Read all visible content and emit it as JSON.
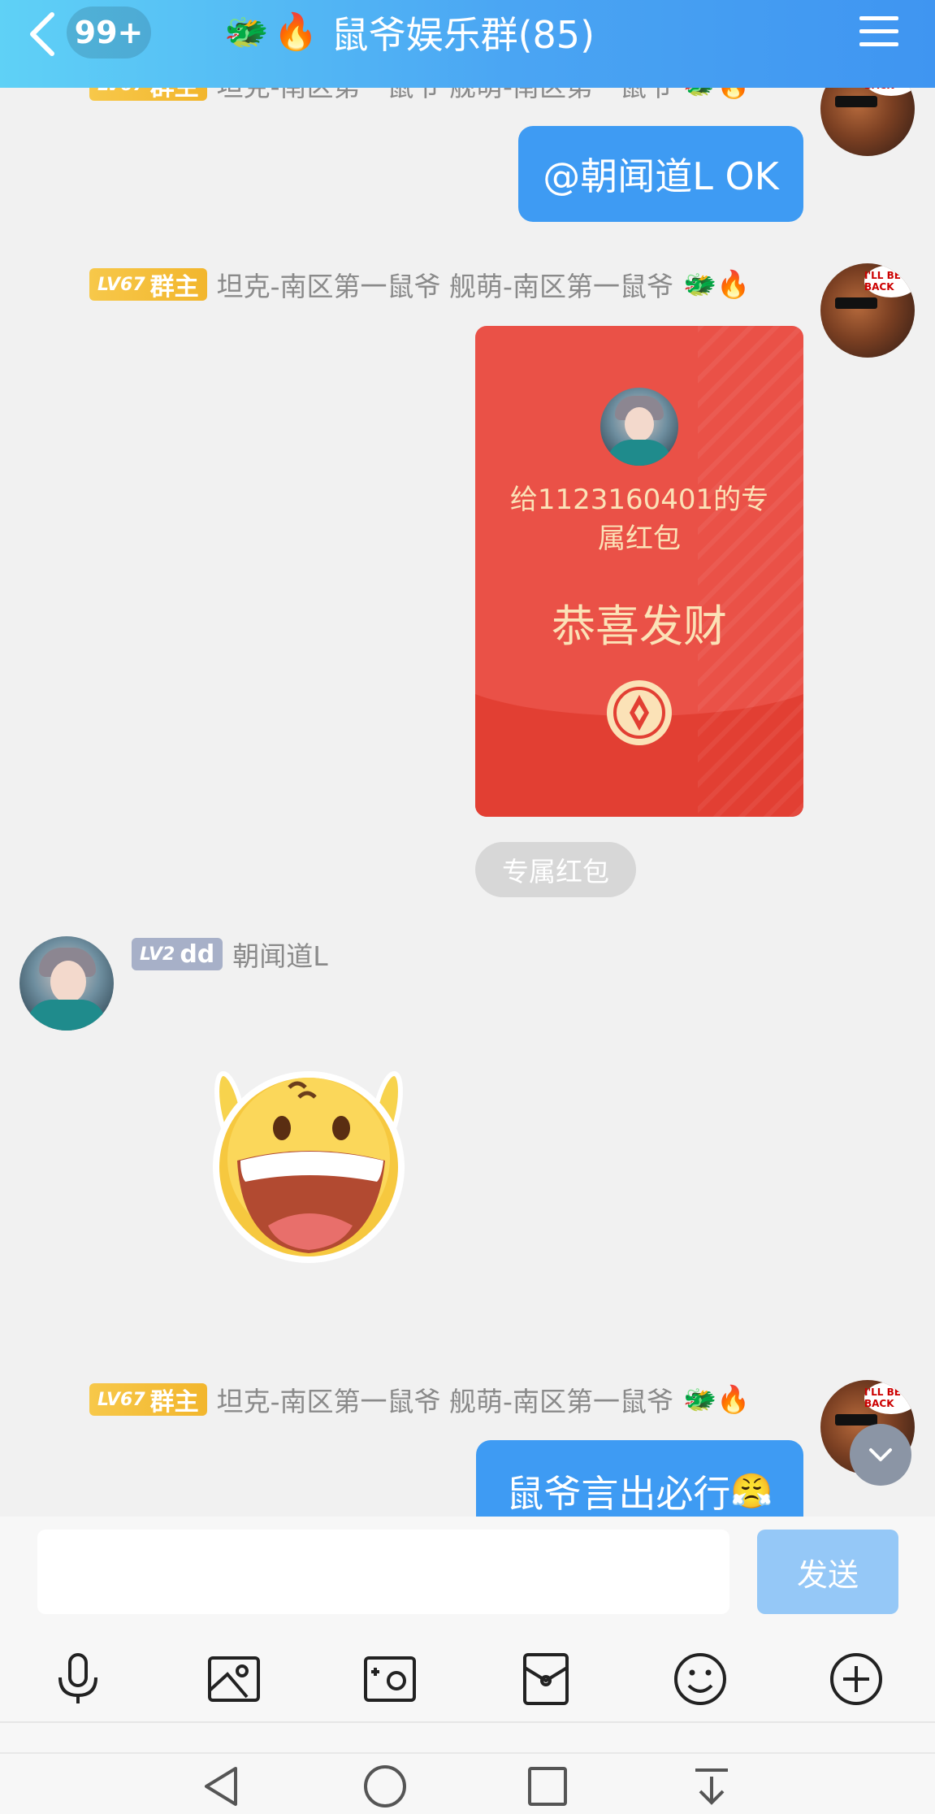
{
  "header": {
    "back_icon": "chevron-left-icon",
    "unread_count": "99+",
    "title_emojis": [
      "🐲",
      "🔥"
    ],
    "title": "鼠爷娱乐群(85)",
    "menu_icon": "hamburger-menu-icon",
    "colors": {
      "gradient_start": "#5fd1f6",
      "gradient_end": "#3f95f1"
    }
  },
  "messages": {
    "sender_owner": {
      "level": "LV67",
      "role": "群主",
      "name": "坦克-南区第一鼠爷 舰萌-南区第一鼠爷",
      "emojis": "🐲🔥",
      "avatar_caption": "I'LL BE BACK"
    },
    "msg1_text": "@朝闻道L OK",
    "red_packet": {
      "recipient_text": "给1123160401的专属红包",
      "greeting": "恭喜发财",
      "label": "专属红包"
    },
    "sender_member": {
      "level": "LV2",
      "role": "dd",
      "name": "朝闻道L"
    },
    "sticker": "laughing-emoji-sticker",
    "msg4_text": "鼠爷言出必行",
    "msg4_emoji": "😤"
  },
  "input": {
    "value": "",
    "placeholder": "",
    "send_label": "发送"
  },
  "toolbar": {
    "icons": [
      "microphone-icon",
      "image-icon",
      "camera-icon",
      "red-packet-icon",
      "emoji-icon",
      "plus-icon"
    ]
  },
  "system_nav": {
    "icons": [
      "nav-back-icon",
      "nav-home-icon",
      "nav-recents-icon",
      "nav-dropdown-icon"
    ]
  },
  "colors": {
    "bubble_blue": "#3e9bf3",
    "red_packet": "#ea5147",
    "gold_badge": "#f2b62d"
  }
}
